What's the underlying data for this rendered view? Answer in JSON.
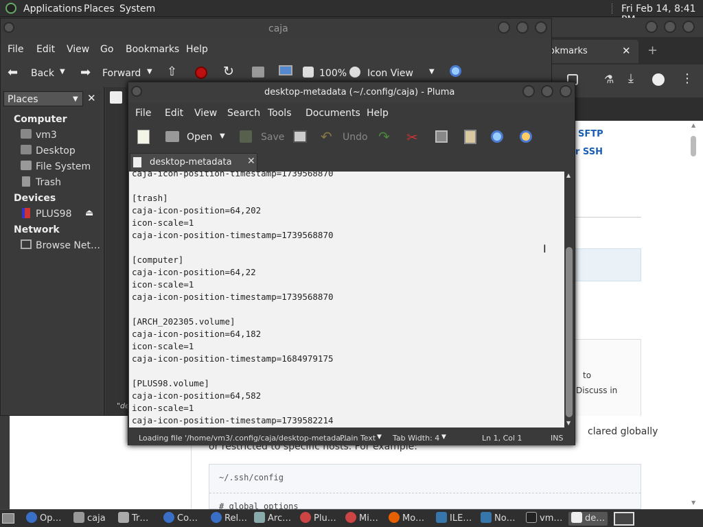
{
  "top_panel": {
    "menus": [
      "Applications",
      "Places",
      "System"
    ],
    "clock": "Fri Feb 14,  8:41 PM"
  },
  "browser": {
    "tab_label": "okmarks",
    "links": [
      "SFTP",
      "r SSH"
    ],
    "snippet_to": "to",
    "snippet_discuss": "Discuss in",
    "body_line1": "clared globally",
    "body_line2": "or restricted to specific hosts. For example:",
    "code_title": "~/.ssh/config",
    "code_line": "# global options"
  },
  "caja": {
    "title": "caja",
    "menu": [
      "File",
      "Edit",
      "View",
      "Go",
      "Bookmarks",
      "Help"
    ],
    "toolbar": {
      "back": "Back",
      "forward": "Forward",
      "zoom": "100%",
      "view_mode": "Icon View"
    },
    "sidebar": {
      "header": "Places",
      "sections": [
        {
          "title": "Computer",
          "items": [
            "vm3",
            "Desktop",
            "File System",
            "Trash"
          ]
        },
        {
          "title": "Devices",
          "items": [
            "PLUS98"
          ]
        },
        {
          "title": "Network",
          "items": [
            "Browse Net…"
          ]
        }
      ]
    },
    "status_fragment": "\"de"
  },
  "pluma": {
    "title": "desktop-metadata (~/.config/caja) - Pluma",
    "menu": [
      "File",
      "Edit",
      "View",
      "Search",
      "Tools",
      "Documents",
      "Help"
    ],
    "toolbar": {
      "open": "Open",
      "save": "Save",
      "undo": "Undo"
    },
    "tab": "desktop-metadata",
    "content": "caja-icon-position-timestamp=1739568870\n\n[trash]\ncaja-icon-position=64,202\nicon-scale=1\ncaja-icon-position-timestamp=1739568870\n\n[computer]\ncaja-icon-position=64,22\nicon-scale=1\ncaja-icon-position-timestamp=1739568870\n\n[ARCH_202305.volume]\ncaja-icon-position=64,182\nicon-scale=1\ncaja-icon-position-timestamp=1684979175\n\n[PLUS98.volume]\ncaja-icon-position=64,582\nicon-scale=1\ncaja-icon-position-timestamp=1739582214",
    "status": {
      "loading": "Loading file '/home/vm3/.config/caja/desktop-metada…",
      "syntax": "Plain Text",
      "tab_width": "Tab Width:  4",
      "position": "Ln 1, Col 1",
      "mode": "INS"
    }
  },
  "taskbar": {
    "items": [
      "Op…",
      "caja",
      "Tr…",
      "Co…",
      "Rel…",
      "Arc…",
      "Plu…",
      "Mi…",
      "Mo…",
      "ILE…",
      "No…",
      "vm…",
      "de…"
    ]
  }
}
